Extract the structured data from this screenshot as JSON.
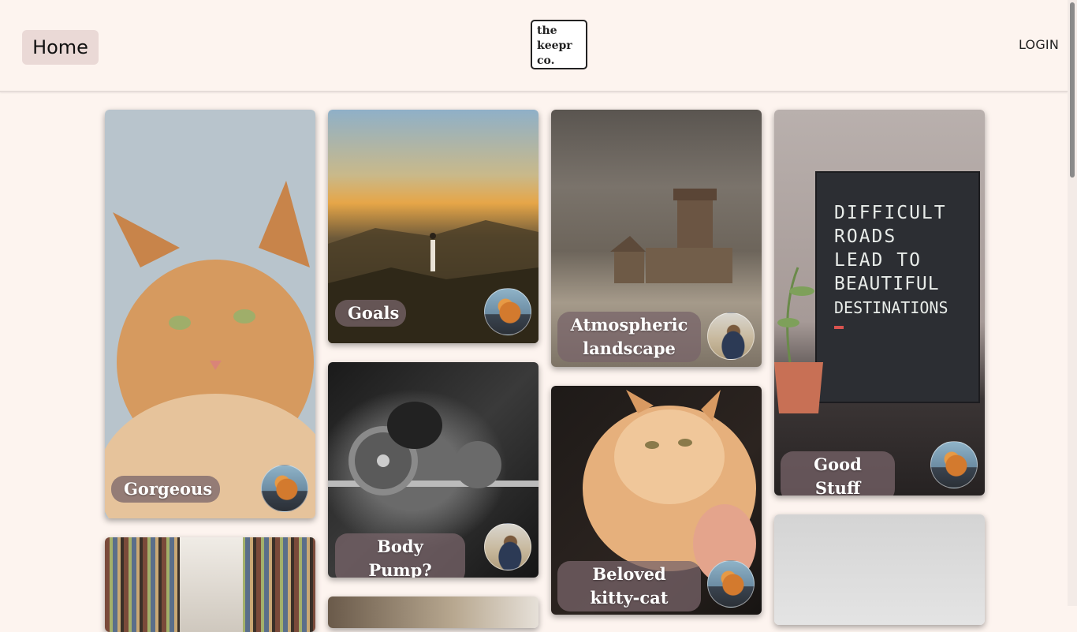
{
  "nav": {
    "home_label": "Home",
    "logo_lines": [
      "the",
      "keepr",
      "co."
    ],
    "login_label": "LOGIN"
  },
  "cards": [
    {
      "title": "Gorgeous",
      "image": "orange-cat-portrait",
      "avatar": "cat-avatar"
    },
    {
      "title": "Goals",
      "image": "yoga-mountain-sunset",
      "avatar": "cat-avatar"
    },
    {
      "title": "Atmospheric landscape",
      "image": "castle-painting",
      "avatar": "man-avatar"
    },
    {
      "title": "Good Stuff",
      "image": "letter-board",
      "avatar": "cat-avatar"
    },
    {
      "title": "Body Pump?",
      "image": "weightlifting-bw",
      "avatar": "man-avatar"
    },
    {
      "title": "Beloved kitty-cat",
      "image": "fluffy-cat-held",
      "avatar": "cat-avatar"
    },
    {
      "title": "",
      "image": "library-shelves",
      "avatar": ""
    },
    {
      "title": "",
      "image": "partial-card",
      "avatar": ""
    },
    {
      "title": "",
      "image": "grey-card",
      "avatar": ""
    }
  ],
  "letterboard_text": [
    "DIFFICULT",
    "ROADS",
    "LEAD TO",
    "BEAUTIFUL",
    "DESTINATIONS"
  ]
}
